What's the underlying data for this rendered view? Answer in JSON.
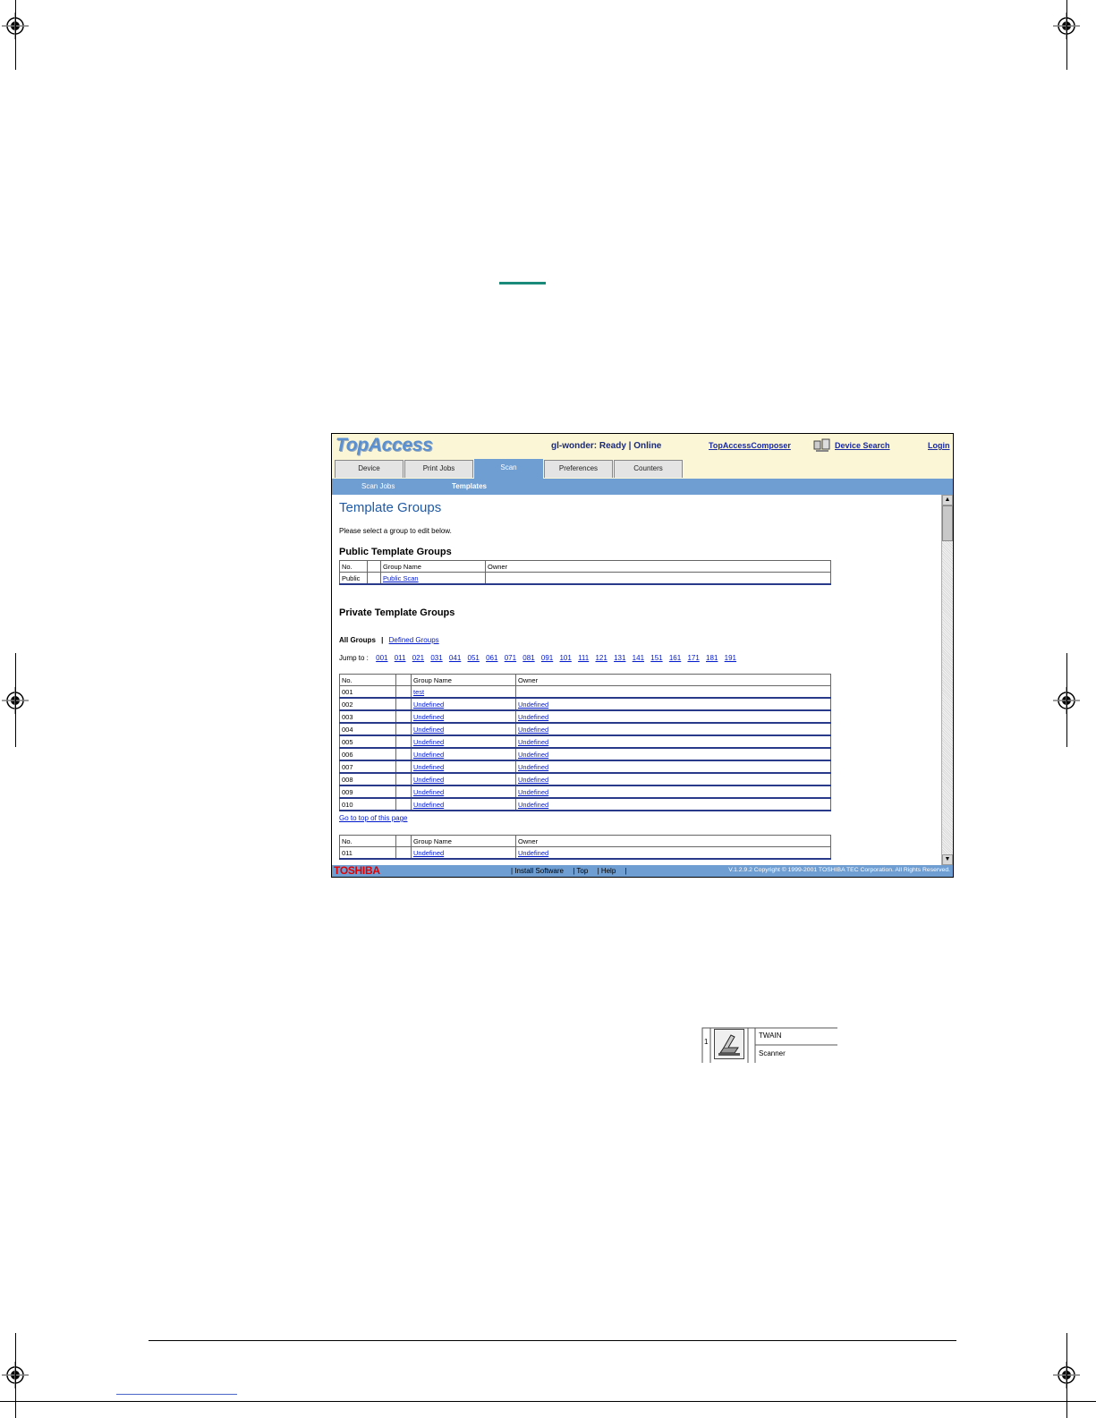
{
  "header": {
    "logo": "TopAccess",
    "status": "gl-wonder: Ready | Online",
    "links": {
      "composer": "TopAccessComposer",
      "device_search": "Device Search",
      "login": "Login"
    }
  },
  "tabs": [
    "Device",
    "Print Jobs",
    "Scan",
    "Preferences",
    "Counters"
  ],
  "active_tab": "Scan",
  "subnav": {
    "scan_jobs": "Scan Jobs",
    "templates": "Templates"
  },
  "page": {
    "title": "Template Groups",
    "intro": "Please select a group to edit below.",
    "public_heading": "Public Template Groups",
    "private_heading": "Private Template Groups"
  },
  "public_table": {
    "headers": [
      "No.",
      "",
      "Group Name",
      "Owner"
    ],
    "rows": [
      [
        "Public",
        "",
        "Public Scan",
        ""
      ]
    ]
  },
  "filter": {
    "all": "All Groups",
    "sep": "|",
    "defined": "Defined Groups"
  },
  "jump": {
    "label": "Jump to :",
    "links": [
      "001",
      "011",
      "021",
      "031",
      "041",
      "051",
      "061",
      "071",
      "081",
      "091",
      "101",
      "111",
      "121",
      "131",
      "141",
      "151",
      "161",
      "171",
      "181",
      "191"
    ]
  },
  "private_table_1": {
    "headers": [
      "No.",
      "",
      "Group Name",
      "Owner"
    ],
    "rows": [
      [
        "001",
        "",
        "test",
        ""
      ],
      [
        "002",
        "",
        "Undefined",
        "Undefined"
      ],
      [
        "003",
        "",
        "Undefined",
        "Undefined"
      ],
      [
        "004",
        "",
        "Undefined",
        "Undefined"
      ],
      [
        "005",
        "",
        "Undefined",
        "Undefined"
      ],
      [
        "006",
        "",
        "Undefined",
        "Undefined"
      ],
      [
        "007",
        "",
        "Undefined",
        "Undefined"
      ],
      [
        "008",
        "",
        "Undefined",
        "Undefined"
      ],
      [
        "009",
        "",
        "Undefined",
        "Undefined"
      ],
      [
        "010",
        "",
        "Undefined",
        "Undefined"
      ]
    ]
  },
  "goto_top": "Go to top of this page",
  "private_table_2": {
    "headers": [
      "No.",
      "",
      "Group Name",
      "Owner"
    ],
    "rows": [
      [
        "011",
        "",
        "Undefined",
        "Undefined"
      ]
    ]
  },
  "footer": {
    "brand": "TOSHIBA",
    "links": [
      "| Install Software",
      "| Top",
      "| Help",
      "|"
    ],
    "copyright": "V.1.2.9.2  Copyright © 1999-2001 TOSHIBA TEC Corporation. All Rights Reserved."
  },
  "twain_inset": {
    "number": "1",
    "line1": "TWAIN",
    "line2": "Scanner"
  },
  "colors": {
    "nav": "#6f9ed3",
    "header_bg": "#fbf6d6",
    "link": "#0018cc",
    "brand": "#e10000"
  }
}
